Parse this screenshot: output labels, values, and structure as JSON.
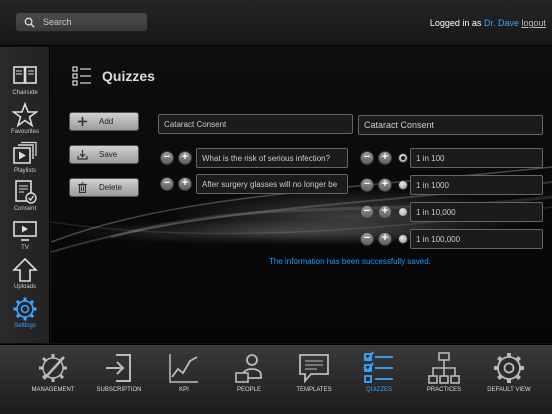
{
  "header": {
    "search_placeholder": "Search",
    "logged_in_label": "Logged in as",
    "user_name": "Dr. Dave",
    "logout_label": "logout"
  },
  "sidebar": {
    "items": [
      {
        "label": "Chairside",
        "icon": "book-icon"
      },
      {
        "label": "Favourites",
        "icon": "star-icon"
      },
      {
        "label": "Playlists",
        "icon": "playlist-icon"
      },
      {
        "label": "Consent",
        "icon": "consent-document-icon"
      },
      {
        "label": "TV",
        "icon": "tv-icon"
      },
      {
        "label": "Uploads",
        "icon": "upload-arrow-icon"
      },
      {
        "label": "Settings",
        "icon": "gear-icon"
      }
    ],
    "active": "Settings"
  },
  "main": {
    "title": "Quizzes",
    "actions": {
      "add": "Add",
      "save": "Save",
      "delete": "Delete"
    },
    "quiz_name_left": "Cataract Consent",
    "quiz_name_right": "Cataract Consent",
    "questions": [
      "What is the risk of serious infection?",
      "After surgery glasses will no longer be"
    ],
    "answers": [
      "1 in 100",
      "1 in 1000",
      "1 in 10,000",
      "1 in 100,000"
    ],
    "selected_answer_index": 0,
    "status": "The information has been successfully saved."
  },
  "bottom_nav": {
    "items": [
      {
        "label": "MANAGEMENT",
        "icon": "management-tools-icon"
      },
      {
        "label": "SUBSCRIPTION",
        "icon": "subscription-login-icon"
      },
      {
        "label": "KPI",
        "icon": "line-graph-icon"
      },
      {
        "label": "PEOPLE",
        "icon": "people-icon"
      },
      {
        "label": "TEMPLATES",
        "icon": "speech-bubble-icon"
      },
      {
        "label": "QUIZZES",
        "icon": "checklist-icon"
      },
      {
        "label": "PRACTICES",
        "icon": "org-chart-icon"
      },
      {
        "label": "DEFAULT VIEW",
        "icon": "gear-icon"
      }
    ],
    "active": "QUIZZES"
  },
  "colors": {
    "accent": "#3aa6ff",
    "status": "#1e9bff"
  }
}
